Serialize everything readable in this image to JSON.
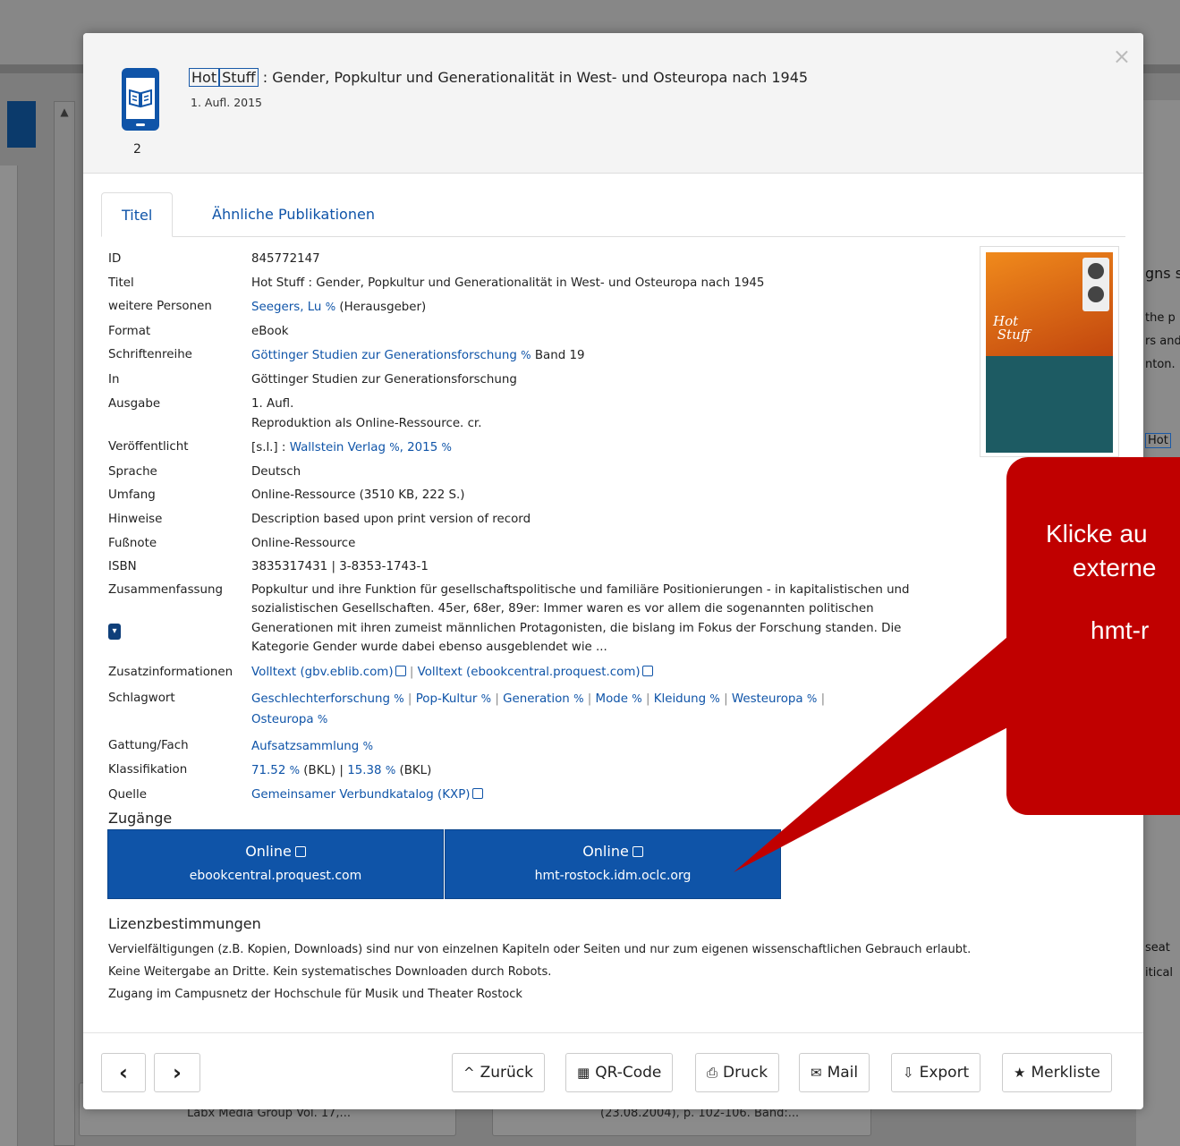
{
  "header": {
    "title_hl1": "Hot",
    "title_hl2": "Stuff",
    "title_rest": " : Gender, Popkultur und Generationalität in West- und Osteuropa nach 1945",
    "subtitle": "1. Aufl. 2015",
    "format_count": "2",
    "format_icon": "ebook-icon",
    "close": "×"
  },
  "tabs": {
    "titel": "Titel",
    "aehnliche": "Ähnliche Publikationen"
  },
  "fields": {
    "id_label": "ID",
    "id_value": "845772147",
    "titel_label": "Titel",
    "titel_value": "Hot Stuff : Gender, Popkultur und Generationalität in West- und Osteuropa nach 1945",
    "personen_label": "weitere Personen",
    "personen_link": "Seegers, Lu",
    "personen_role": "(Herausgeber)",
    "format_label": "Format",
    "format_value": "eBook",
    "reihe_label": "Schriftenreihe",
    "reihe_link": "Göttinger Studien zur Generationsforschung",
    "reihe_band": "Band 19",
    "in_label": "In",
    "in_value": "Göttinger Studien zur Generationsforschung",
    "ausgabe_label": "Ausgabe",
    "ausgabe_value1": "1. Aufl.",
    "ausgabe_value2": "Reproduktion als Online-Ressource. cr.",
    "veroeff_label": "Veröffentlicht",
    "veroeff_prefix": "[s.l.] :",
    "veroeff_link1": "Wallstein Verlag",
    "veroeff_link2": ", 2015",
    "sprache_label": "Sprache",
    "sprache_value": "Deutsch",
    "umfang_label": "Umfang",
    "umfang_value": "Online-Ressource (3510 KB, 222 S.)",
    "hinweise_label": "Hinweise",
    "hinweise_value": "Description based upon print version of record",
    "fussnote_label": "Fußnote",
    "fussnote_value": "Online-Ressource",
    "isbn_label": "ISBN",
    "isbn_value": "3835317431 | 3-8353-1743-1",
    "zusammen_label": "Zusammenfassung",
    "zusammen_value": "Popkultur und ihre Funktion für gesellschaftspolitische und familiäre Positionierungen - in kapitalistischen und sozialistischen Gesellschaften. 45er, 68er, 89er: Immer waren es vor allem die sogenannten politischen Generationen mit ihren zumeist männlichen Protagonisten, die bislang im Fokus der Forschung standen. Die Kategorie Gender wurde dabei ebenso ausgeblendet wie ...",
    "zusatz_label": "Zusatzinformationen",
    "zusatz_link1": "Volltext (gbv.eblib.com)",
    "zusatz_link2": "Volltext (ebookcentral.proquest.com)",
    "schlag_label": "Schlagwort",
    "schlag_items": [
      "Geschlechterforschung",
      "Pop-Kultur",
      "Generation",
      "Mode",
      "Kleidung",
      "Westeuropa",
      "Osteuropa"
    ],
    "gattung_label": "Gattung/Fach",
    "gattung_link": "Aufsatzsammlung",
    "klass_label": "Klassifikation",
    "klass_link1": "71.52",
    "klass_note1": "(BKL) |",
    "klass_link2": "15.38",
    "klass_note2": "(BKL)",
    "quelle_label": "Quelle",
    "quelle_link": "Gemeinsamer Verbundkatalog (KXP)"
  },
  "zugaenge": {
    "heading": "Zugänge",
    "btn1_label": "Online",
    "btn1_host": "ebookcentral.proquest.com",
    "btn2_label": "Online",
    "btn2_host": "hmt-rostock.idm.oclc.org"
  },
  "lizenz": {
    "heading": "Lizenzbestimmungen",
    "line1": "Vervielfältigungen (z.B. Kopien, Downloads) sind nur von einzelnen Kapiteln oder Seiten und nur zum eigenen wissenschaftlichen Gebrauch erlaubt.",
    "line2": "Keine Weitergabe an Dritte. Kein systematisches Downloaden durch Robots.",
    "line3": "Zugang im Campusnetz der Hochschule für Musik und Theater Rostock"
  },
  "footer": {
    "prev": "‹",
    "next": "›",
    "zurueck": "Zurück",
    "qr": "QR-Code",
    "druck": "Druck",
    "mail": "Mail",
    "export": "Export",
    "merkliste": "Merkliste"
  },
  "callout": {
    "line1": "Klicke au",
    "line2": "externe",
    "line3": "hmt-r"
  },
  "background": {
    "right1": "gns s",
    "right2": "the p",
    "right3": "rs and",
    "right4": "nton.",
    "right5": "Hot",
    "right6": "seat",
    "right7": "itical",
    "card1": "Labx Media Group Vol. 17,...",
    "card2": "(23.08.2004), p. 102-106. Band:..."
  }
}
